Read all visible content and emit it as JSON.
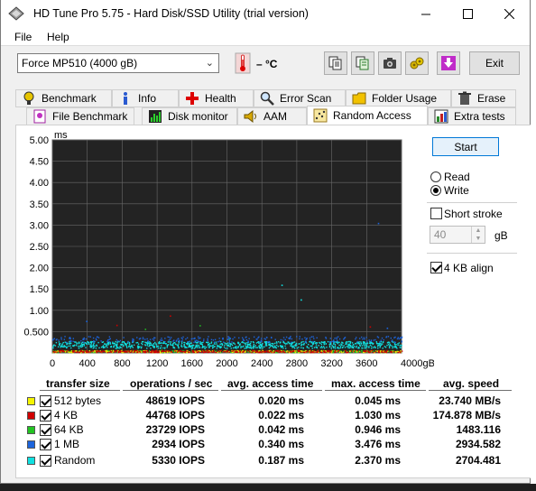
{
  "window": {
    "title": "HD Tune Pro 5.75 - Hard Disk/SSD Utility (trial version)"
  },
  "menu": [
    {
      "label": "File",
      "accel": "F"
    },
    {
      "label": "Help",
      "accel": "H"
    }
  ],
  "toolbar": {
    "drive": "Force MP510 (4000 gB)",
    "temperature": "– °C",
    "exit_label": "Exit",
    "icons": [
      "copy-info-icon",
      "copy-text-icon",
      "screenshot-icon",
      "options-icon",
      "save-icon"
    ]
  },
  "tabs_row1": [
    {
      "label": "Benchmark",
      "icon": "benchmark-icon"
    },
    {
      "label": "Info",
      "icon": "info-icon"
    },
    {
      "label": "Health",
      "icon": "health-icon"
    },
    {
      "label": "Error Scan",
      "icon": "error-scan-icon"
    },
    {
      "label": "Folder Usage",
      "icon": "folder-usage-icon"
    },
    {
      "label": "Erase",
      "icon": "erase-icon"
    }
  ],
  "tabs_row2": [
    {
      "label": "File Benchmark",
      "icon": "file-benchmark-icon"
    },
    {
      "label": "Disk monitor",
      "icon": "disk-monitor-icon"
    },
    {
      "label": "AAM",
      "icon": "aam-icon"
    },
    {
      "label": "Random Access",
      "icon": "random-access-icon",
      "active": true
    },
    {
      "label": "Extra tests",
      "icon": "extra-tests-icon"
    }
  ],
  "controls": {
    "start_label": "Start",
    "mode_options": [
      "Read",
      "Write"
    ],
    "mode_selected": "Write",
    "short_stroke_label": "Short stroke",
    "short_stroke_checked": false,
    "short_stroke_value": "40",
    "short_stroke_unit": "gB",
    "align_label": "4 KB align",
    "align_checked": true
  },
  "chart_data": {
    "type": "scatter",
    "ylabel": "ms",
    "y_ticks": [
      "5.00",
      "4.50",
      "4.00",
      "3.50",
      "3.00",
      "2.50",
      "2.00",
      "1.50",
      "1.00",
      "0.500"
    ],
    "x_ticks": [
      "0",
      "400",
      "800",
      "1200",
      "1600",
      "2000",
      "2400",
      "2800",
      "3200",
      "3600",
      "4000gB"
    ],
    "xlim": [
      0,
      4000
    ],
    "ylim": [
      0,
      5.0
    ],
    "grid": true,
    "background": "#232323",
    "series": [
      {
        "name": "512 bytes",
        "color": "#e8e000",
        "avg_ms": 0.02,
        "max_ms": 0.045
      },
      {
        "name": "4 KB",
        "color": "#cc0000",
        "avg_ms": 0.022,
        "max_ms": 1.03
      },
      {
        "name": "64 KB",
        "color": "#22b422",
        "avg_ms": 0.042,
        "max_ms": 0.946
      },
      {
        "name": "1 MB",
        "color": "#1c64dc",
        "avg_ms": 0.34,
        "max_ms": 3.476
      },
      {
        "name": "Random",
        "color": "#10e0e0",
        "avg_ms": 0.187,
        "max_ms": 2.37
      }
    ]
  },
  "results": {
    "headers": [
      "transfer size",
      "operations / sec",
      "avg. access time",
      "max. access time",
      "avg. speed"
    ],
    "rows": [
      {
        "size": "512 bytes",
        "color": "#f5f500",
        "checked": true,
        "ops": "48619 IOPS",
        "avg": "0.020 ms",
        "max": "0.045 ms",
        "speed": "23.740 MB/s"
      },
      {
        "size": "4 KB",
        "color": "#d00000",
        "checked": true,
        "ops": "44768 IOPS",
        "avg": "0.022 ms",
        "max": "1.030 ms",
        "speed": "174.878 MB/s"
      },
      {
        "size": "64 KB",
        "color": "#22c422",
        "checked": true,
        "ops": "23729 IOPS",
        "avg": "0.042 ms",
        "max": "0.946 ms",
        "speed": "1483.116"
      },
      {
        "size": "1 MB",
        "color": "#1c64dc",
        "checked": true,
        "ops": "2934 IOPS",
        "avg": "0.340 ms",
        "max": "3.476 ms",
        "speed": "2934.582"
      },
      {
        "size": "Random",
        "color": "#10e0e0",
        "checked": true,
        "ops": "5330 IOPS",
        "avg": "0.187 ms",
        "max": "2.370 ms",
        "speed": "2704.481"
      }
    ]
  }
}
